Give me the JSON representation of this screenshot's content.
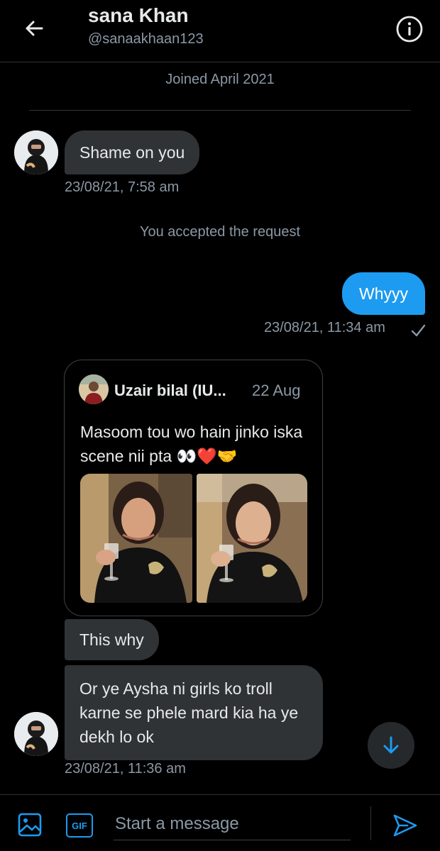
{
  "header": {
    "name": "sana Khan",
    "handle": "@sanaakhaan123",
    "back_icon": "arrow-left-icon",
    "info_icon": "info-circle-icon"
  },
  "profile": {
    "joined": "Joined April 2021"
  },
  "messages": {
    "m1": {
      "text": "Shame on you",
      "time": "23/08/21, 7:58 am"
    },
    "system": "You accepted the request",
    "m2": {
      "text": "Whyyy",
      "time": "23/08/21, 11:34 am",
      "status_icon": "checkmark-icon"
    },
    "quoted_tweet": {
      "author": "Uzair bilal (IU...",
      "date": "22 Aug",
      "text": "Masoom tou wo hain jinko iska scene nii pta 👀❤️🤝"
    },
    "m3": {
      "text": "This why"
    },
    "m4": {
      "text": "Or ye Aysha ni girls ko troll karne se phele mard kia ha ye dekh lo ok",
      "time": "23/08/21, 11:36 am"
    }
  },
  "composer": {
    "placeholder": "Start a message",
    "media_icon": "image-icon",
    "gif_label": "GIF",
    "send_icon": "send-icon",
    "scroll_icon": "arrow-down-icon"
  },
  "colors": {
    "background": "#000000",
    "accent": "#1d9bf0",
    "bubble_incoming": "#2f3336",
    "muted_text": "#8b98a5"
  }
}
